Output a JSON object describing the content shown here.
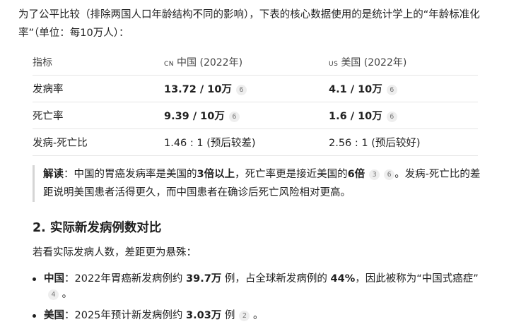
{
  "intro": {
    "text": "为了公平比较（排除两国人口年龄结构不同的影响），下表的核心数据使用的是统计学上的“年龄标准化率”（单位：每10万人）："
  },
  "table": {
    "headers": {
      "metric": "指标",
      "cn_flag": "CN",
      "cn_label": "中国 (2022年)",
      "us_flag": "US",
      "us_label": "美国 (2022年)"
    },
    "rows": [
      {
        "metric": "发病率",
        "cn": "13.72 / 10万",
        "cn_cite": "6",
        "us": "4.1 / 10万",
        "us_cite": "6"
      },
      {
        "metric": "死亡率",
        "cn": "9.39 / 10万",
        "cn_cite": "6",
        "us": "1.6 / 10万",
        "us_cite": "6"
      },
      {
        "metric": "发病-死亡比",
        "cn": "1.46 : 1 (预后较差)",
        "us": "2.56 : 1 (预后较好)"
      }
    ]
  },
  "interpretation": {
    "label": "解读",
    "sep": "：",
    "p1": "中国的胃癌发病率是美国的",
    "b1": "3倍以上",
    "p2": "，死亡率更是接近美国的",
    "b2": "6倍",
    "cite1": "3",
    "cite2": "6",
    "p3": "。发病-死亡比的差距说明美国患者活得更久，而中国患者在确诊后死亡风险相对更高。"
  },
  "section": {
    "heading": "2. 实际新发病例数对比",
    "lead": "若看实际发病人数，差距更为悬殊："
  },
  "bullets": [
    {
      "label": "中国",
      "sep": "：",
      "t1": "2022年胃癌新发病例约 ",
      "b1": "39.7万",
      "t2": " 例，占全球新发病例的 ",
      "b2": "44%",
      "t3": "，因此被称为“中国式癌症”",
      "cite": "4",
      "t4": " 。"
    },
    {
      "label": "美国",
      "sep": "：",
      "t1": "2025年预计新发病例约 ",
      "b1": "3.03万",
      "t2": " 例",
      "cite": "2",
      "t3": " 。"
    }
  ]
}
